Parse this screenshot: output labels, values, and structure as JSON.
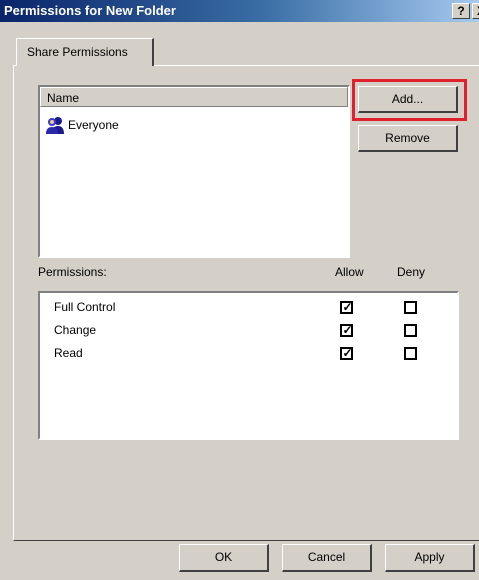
{
  "window": {
    "title": "Permissions for New Folder",
    "help_label": "?",
    "close_label": "X"
  },
  "tabs": [
    {
      "label": "Share Permissions",
      "active": true
    }
  ],
  "names": {
    "header": "Name",
    "items": [
      {
        "label": "Everyone",
        "icon": "group-users-icon",
        "selected": true
      }
    ]
  },
  "buttons": {
    "add": "Add...",
    "remove": "Remove",
    "ok": "OK",
    "cancel": "Cancel",
    "apply": "Apply"
  },
  "highlight_color": "#e0202c",
  "permissions": {
    "label": "Permissions:",
    "allow_header": "Allow",
    "deny_header": "Deny",
    "items": [
      {
        "label": "Full Control",
        "allow": true,
        "deny": false
      },
      {
        "label": "Change",
        "allow": true,
        "deny": false
      },
      {
        "label": "Read",
        "allow": true,
        "deny": false
      }
    ]
  }
}
